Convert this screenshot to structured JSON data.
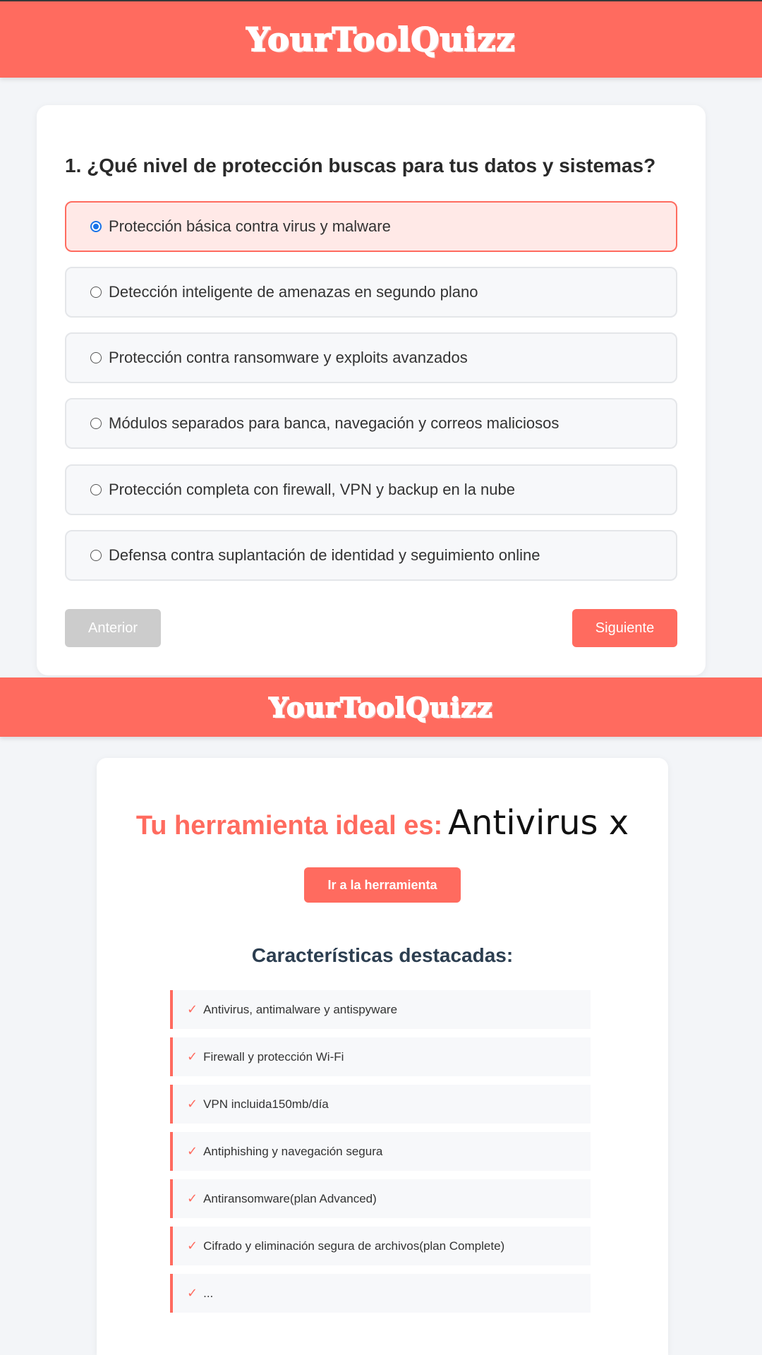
{
  "brand": {
    "logo": "YourToolQuizz"
  },
  "quiz": {
    "question": "1. ¿Qué nivel de protección buscas para tus datos y sistemas?",
    "options": [
      {
        "label": "Protección básica contra virus y malware",
        "selected": true
      },
      {
        "label": "Detección inteligente de amenazas en segundo plano",
        "selected": false
      },
      {
        "label": "Protección contra ransomware y exploits avanzados",
        "selected": false
      },
      {
        "label": "Módulos separados para banca, navegación y correos maliciosos",
        "selected": false
      },
      {
        "label": "Protección completa con firewall, VPN y backup en la nube",
        "selected": false
      },
      {
        "label": "Defensa contra suplantación de identidad y seguimiento online",
        "selected": false
      }
    ],
    "prev_label": "Anterior",
    "next_label": "Siguiente"
  },
  "result": {
    "label": "Tu herramienta ideal es:",
    "tool_name": "Antivirus x",
    "go_label": "Ir a la herramienta",
    "features_title": "Características destacadas:",
    "check_icon": "✓",
    "features": [
      "Antivirus, antimalware y antispyware",
      "Firewall y protección Wi-Fi",
      "VPN incluida150mb/día",
      "Antiphishing y navegación segura",
      "Antiransomware(plan Advanced)",
      "Cifrado y eliminación segura de archivos(plan Complete)",
      "..."
    ]
  },
  "colors": {
    "accent": "#ff6b5f",
    "selected_bg": "#ffe9e7",
    "radio": "#1a73e8",
    "disabled": "#cccccc"
  }
}
